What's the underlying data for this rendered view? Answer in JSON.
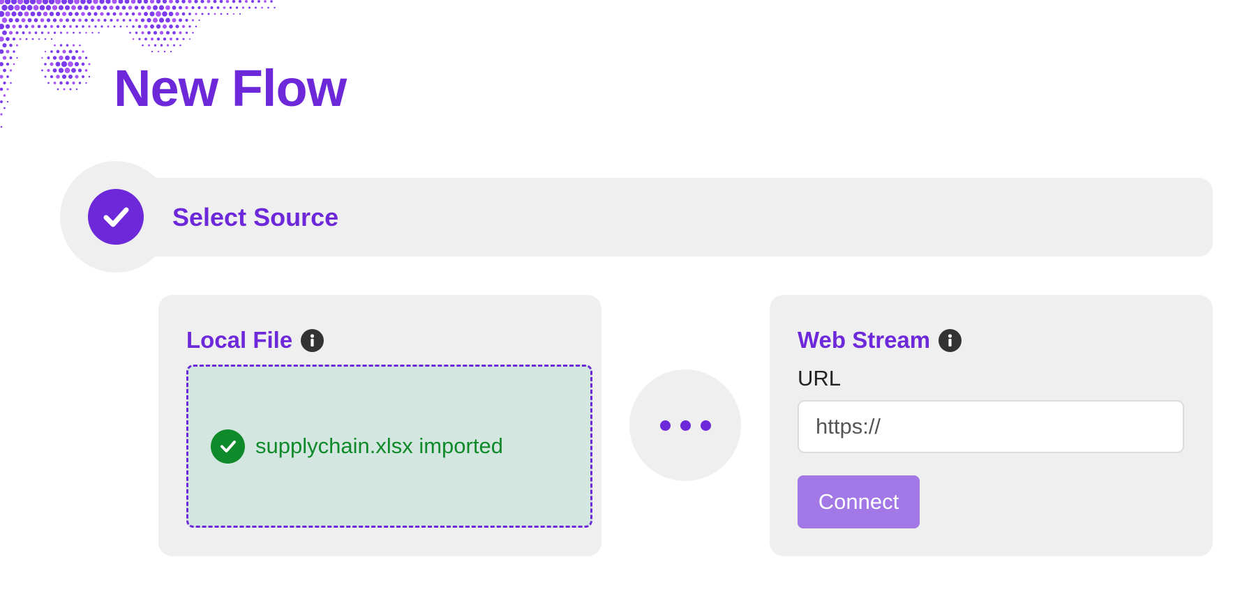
{
  "page": {
    "title": "New Flow"
  },
  "colors": {
    "accent": "#6d28d9",
    "accent_light": "#a277e6",
    "success": "#0f8a2a",
    "success_bg": "#d3e6df",
    "panel_bg": "#efefef",
    "info_icon": "#333333"
  },
  "step": {
    "label": "Select Source",
    "status": "complete",
    "icon": "checkmark-icon"
  },
  "local_file": {
    "title": "Local File",
    "info_icon": "info-icon",
    "status_icon": "check-circle-icon",
    "status_text": "supplychain.xlsx imported"
  },
  "separator": {
    "icon": "more-horizontal-icon"
  },
  "web_stream": {
    "title": "Web Stream",
    "info_icon": "info-icon",
    "url_label": "URL",
    "url_placeholder": "https://",
    "url_value": "",
    "connect_label": "Connect"
  }
}
